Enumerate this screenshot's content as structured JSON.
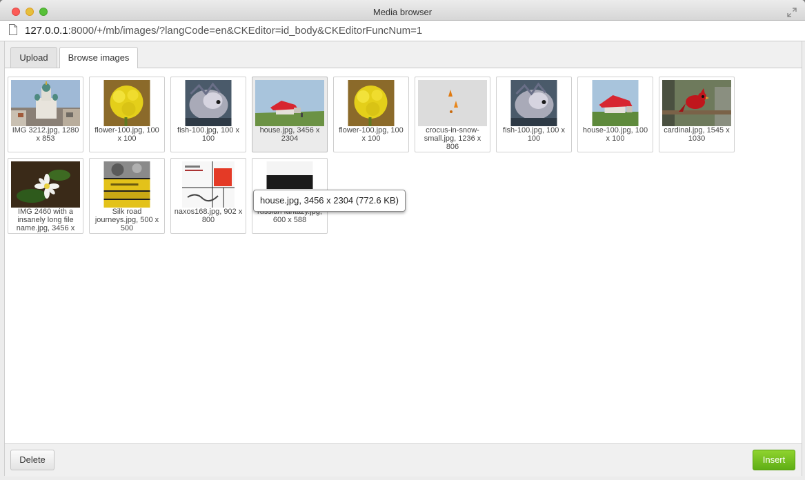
{
  "window": {
    "title": "Media browser"
  },
  "urlbar": {
    "host": "127.0.0.1",
    "rest": ":8000/+/mb/images/?langCode=en&CKEditor=id_body&CKEditorFuncNum=1"
  },
  "tabs": [
    {
      "label": "Upload",
      "active": false
    },
    {
      "label": "Browse images",
      "active": true
    }
  ],
  "images": [
    {
      "caption": "IMG 3212.jpg, 1280 x 853",
      "subject": "cathedral-city-photo"
    },
    {
      "caption": "flower-100.jpg, 100 x 100",
      "subject": "yellow-flower-photo"
    },
    {
      "caption": "fish-100.jpg, 100 x 100",
      "subject": "fish-photo"
    },
    {
      "caption": "house.jpg, 3456 x 2304",
      "subject": "red-house-photo",
      "selected": true
    },
    {
      "caption": "flower-100.jpg, 100 x 100",
      "subject": "yellow-flower-photo"
    },
    {
      "caption": "crocus-in-snow-small.jpg, 1236 x 806",
      "subject": "crocus-in-snow-photo"
    },
    {
      "caption": "fish-100.jpg, 100 x 100",
      "subject": "fish-photo"
    },
    {
      "caption": "house-100.jpg, 100 x 100",
      "subject": "red-house-photo"
    },
    {
      "caption": "cardinal.jpg, 1545 x 1030",
      "subject": "cardinal-bird-photo"
    },
    {
      "caption": "IMG 2460 with a insanely long file name.jpg, 3456 x",
      "subject": "white-flower-photo"
    },
    {
      "caption": "Silk road journeys.jpg, 500 x 500",
      "subject": "album-cover-yellow"
    },
    {
      "caption": "naxos168.jpg, 902 x 800",
      "subject": "album-cover-red-square"
    },
    {
      "caption": "russian fantazy.jpg, 600 x 588",
      "subject": "album-cover-keyboard"
    }
  ],
  "tooltip": {
    "text": "house.jpg, 3456 x 2304 (772.6 KB)"
  },
  "footer": {
    "delete_label": "Delete",
    "insert_label": "Insert"
  },
  "colors": {
    "insert_button": "#6bbf1c",
    "house_roof": "#d72630",
    "flower": "#e8d21a",
    "cardinal": "#c0171c"
  }
}
